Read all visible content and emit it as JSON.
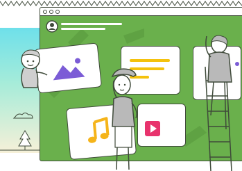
{
  "window": {
    "controls": [
      "close-dot",
      "minimize-dot",
      "maximize-dot"
    ]
  },
  "icons": {
    "profile": "avatar-icon",
    "image": "image-icon",
    "music": "music-note-icon",
    "video": "play-icon"
  },
  "colors": {
    "window_green": "#6ab04c",
    "image_purple": "#7b5cd6",
    "text_line_yellow": "#f4c20d",
    "music_orange": "#f5b41a",
    "play_pink": "#e8336d",
    "outline": "#3f4a3a"
  }
}
